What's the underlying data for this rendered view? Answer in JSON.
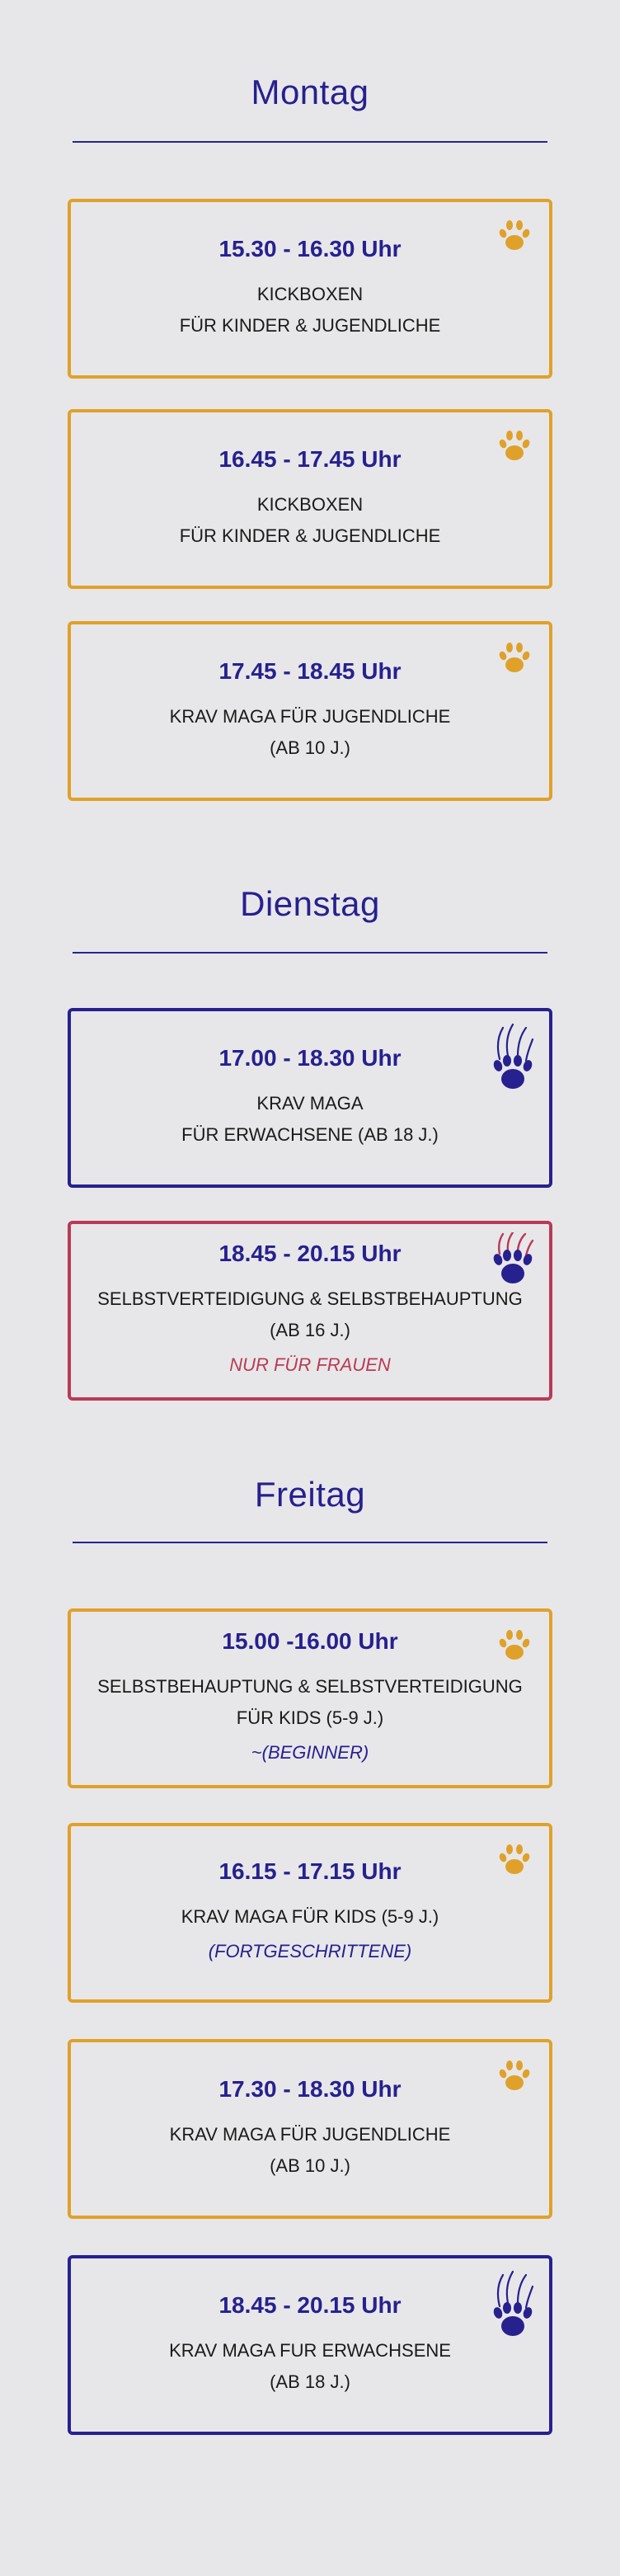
{
  "colors": {
    "accent_blue": "#27208f",
    "kids_orange": "#e0a12a",
    "women_red": "#b93a55",
    "background": "#e7e7e9"
  },
  "days": [
    {
      "name": "Montag",
      "classes": [
        {
          "time": "15.30 - 16.30 Uhr",
          "lines": [
            "KICKBOXEN",
            "FÜR KINDER & JUGENDLICHE"
          ],
          "icon": "paw-icon"
        },
        {
          "time": "16.45 - 17.45 Uhr",
          "lines": [
            "KICKBOXEN",
            "FÜR KINDER & JUGENDLICHE"
          ],
          "icon": "paw-icon"
        },
        {
          "time": "17.45 - 18.45 Uhr",
          "lines": [
            "KRAV MAGA FÜR JUGENDLICHE",
            "(AB 10 J.)"
          ],
          "icon": "paw-icon"
        }
      ]
    },
    {
      "name": "Dienstag",
      "classes": [
        {
          "time": "17.00 - 18.30 Uhr",
          "lines": [
            "KRAV MAGA",
            "FÜR ERWACHSENE (AB 18 J.)"
          ],
          "icon": "bear-claw-icon"
        },
        {
          "time": "18.45 - 20.15 Uhr",
          "lines": [
            "SELBSTVERTEIDIGUNG & SELBSTBEHAUPTUNG",
            "(AB 16 J.)"
          ],
          "note": "NUR FÜR FRAUEN",
          "icon": "bear-claw-icon"
        }
      ]
    },
    {
      "name": "Freitag",
      "classes": [
        {
          "time": "15.00 -16.00 Uhr",
          "lines": [
            "SELBSTBEHAUPTUNG & SELBSTVERTEIDIGUNG",
            "FÜR KIDS (5-9 J.)"
          ],
          "note": "~(BEGINNER)",
          "icon": "paw-icon"
        },
        {
          "time": "16.15 - 17.15 Uhr",
          "lines": [
            "KRAV MAGA FÜR KIDS (5-9 J.)"
          ],
          "note": "(FORTGESCHRITTENE)",
          "icon": "paw-icon"
        },
        {
          "time": "17.30 - 18.30 Uhr",
          "lines": [
            "KRAV MAGA FÜR JUGENDLICHE",
            "(AB 10 J.)"
          ],
          "icon": "paw-icon"
        },
        {
          "time": "18.45 - 20.15 Uhr",
          "lines": [
            "KRAV MAGA FUR ERWACHSENE",
            "(AB 18 J.)"
          ],
          "icon": "bear-claw-icon"
        }
      ]
    }
  ]
}
